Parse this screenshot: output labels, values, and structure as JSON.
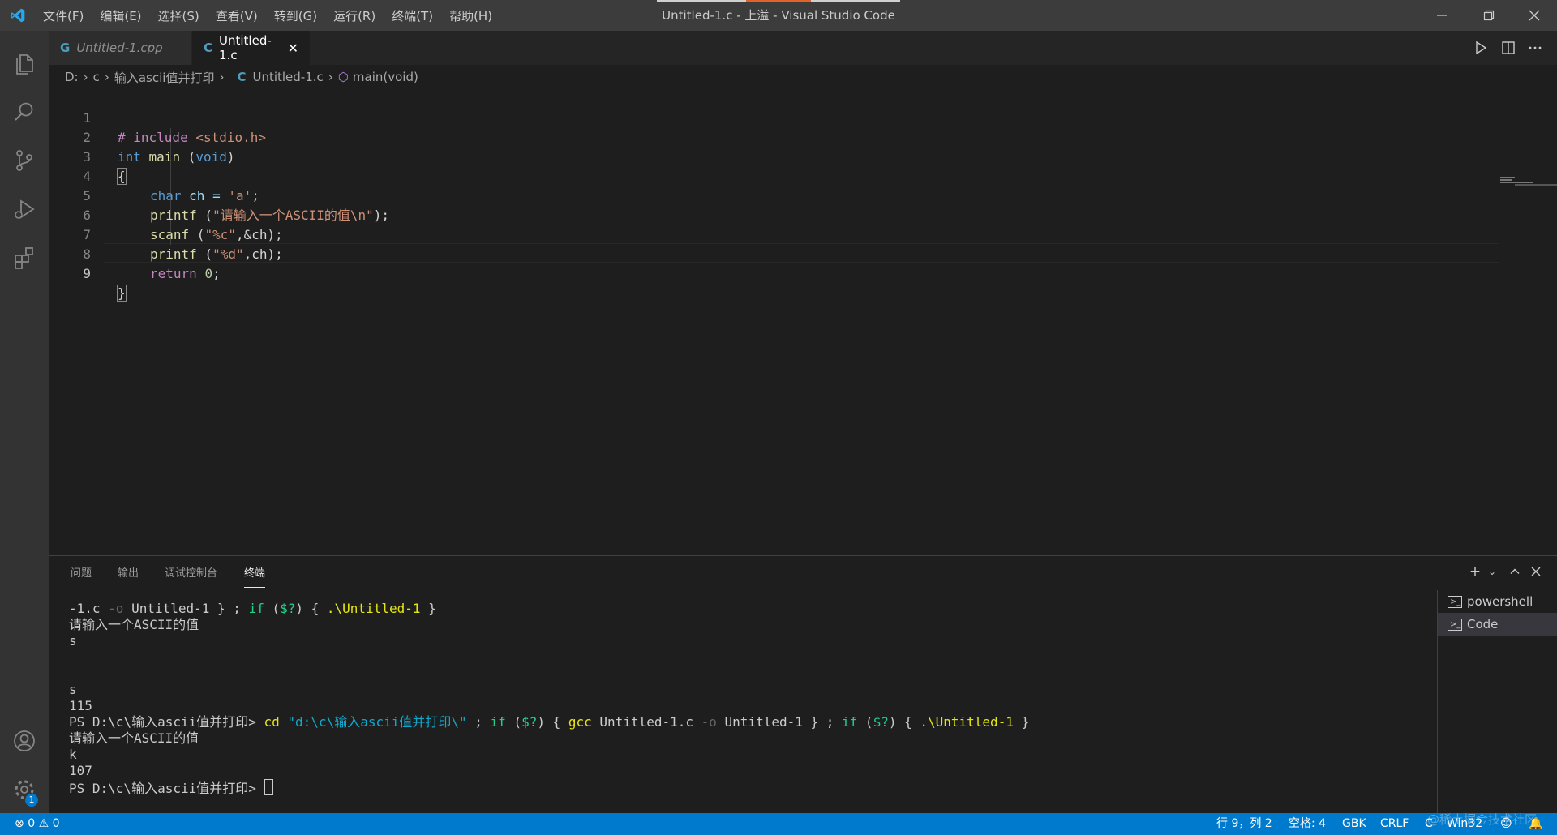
{
  "window": {
    "title": "Untitled-1.c - 上溢 - Visual Studio Code",
    "menu": [
      "文件(F)",
      "编辑(E)",
      "选择(S)",
      "查看(V)",
      "转到(G)",
      "运行(R)",
      "终端(T)",
      "帮助(H)"
    ]
  },
  "tabs": [
    {
      "label": "Untitled-1.cpp",
      "icon": "G",
      "active": false
    },
    {
      "label": "Untitled-1.c",
      "icon": "C",
      "active": true
    }
  ],
  "breadcrumb": {
    "drive": "D:",
    "folder1": "c",
    "folder2": "输入ascii值并打印",
    "file": "Untitled-1.c",
    "symbol": "main(void)"
  },
  "editor": {
    "line_numbers": [
      "1",
      "2",
      "3",
      "4",
      "5",
      "6",
      "7",
      "8",
      "9"
    ],
    "l1": {
      "a": "# include ",
      "b": "<stdio.h>"
    },
    "l2": {
      "a": "int",
      "b": " main ",
      "c": "(",
      "d": "void",
      "e": ")"
    },
    "l3": {
      "a": "{"
    },
    "l4": {
      "a": "char",
      "b": " ch = ",
      "c": "'a'",
      "d": ";"
    },
    "l5": {
      "a": "printf",
      "b": " (",
      "c": "\"请输入一个ASCII的值\\n\"",
      "d": ");"
    },
    "l6": {
      "a": "scanf",
      "b": " (",
      "c": "\"%c\"",
      "d": ",&ch);"
    },
    "l7": {
      "a": "printf",
      "b": " (",
      "c": "\"%d\"",
      "d": ",ch);"
    },
    "l8": {
      "a": "return",
      "b": " ",
      "c": "0",
      "d": ";"
    },
    "l9": {
      "a": "}"
    }
  },
  "panel": {
    "tabs": [
      "问题",
      "输出",
      "调试控制台",
      "终端"
    ],
    "active_tab": "终端",
    "terminals": [
      "powershell",
      "Code"
    ],
    "terminal": {
      "r1": {
        "a": "-1.c ",
        "b": "-o",
        "c": " Untitled-1 } ; ",
        "d": "if",
        "e": " (",
        "f": "$?",
        "g": ") { ",
        "h": ".\\Untitled-1",
        "i": " }"
      },
      "r2": "请输入一个ASCII的值",
      "r3": "s",
      "r4": "",
      "r5": "",
      "r6": "s",
      "r7": "115",
      "r8": {
        "a": "PS D:\\c\\输入ascii值并打印> ",
        "b": "cd",
        "c": " ",
        "d": "\"d:\\c\\输入ascii值并打印\\\"",
        "e": " ; ",
        "f": "if",
        "g": " (",
        "h": "$?",
        "i": ") { ",
        "j": "gcc",
        "k": " Untitled-1.c ",
        "l": "-o",
        "m": " Untitled-1 } ; ",
        "n": "if",
        "o": " (",
        "p": "$?",
        "q": ") { ",
        "r": ".\\Untitled-1",
        "s": " }"
      },
      "r9": "请输入一个ASCII的值",
      "r10": "k",
      "r11": "107",
      "r12": "PS D:\\c\\输入ascii值并打印> "
    }
  },
  "statusbar": {
    "errors": "0",
    "warnings": "0",
    "position": "行 9，列 2",
    "spaces": "空格: 4",
    "encoding": "GBK",
    "eol": "CRLF",
    "language": "C",
    "platform": "Win32",
    "watermark": "@稀土掘金技术社区"
  },
  "accounts_badge": "1",
  "colors": {
    "accent": "#007acc",
    "titlebar": "#3c3c3c",
    "activitybar": "#333333",
    "editor": "#1e1e1e"
  }
}
